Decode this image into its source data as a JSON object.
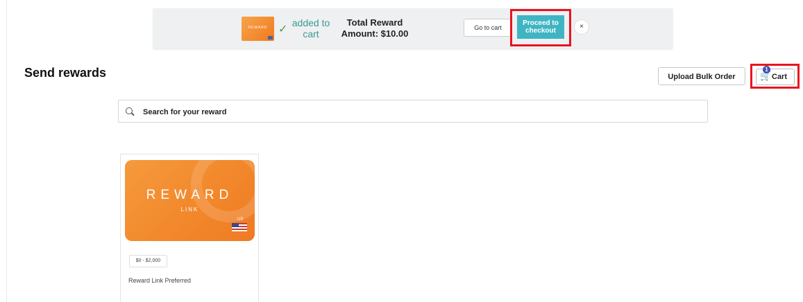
{
  "notification": {
    "card_thumbnail_text": "REWARD",
    "added_line1": "added to",
    "added_line2": "cart",
    "total_line1": "Total Reward",
    "total_line2": "Amount: $10.00",
    "go_to_cart_label": "Go to cart",
    "proceed_line1": "Proceed to",
    "proceed_line2": "checkout",
    "close_label": "×"
  },
  "header": {
    "title": "Send rewards",
    "upload_bulk_label": "Upload Bulk Order",
    "cart_label": "Cart",
    "cart_count": "1"
  },
  "search": {
    "placeholder": "Search for your reward"
  },
  "rewards": [
    {
      "brand": "REWARD",
      "brand_sub": "LINK",
      "region": "US",
      "price_range": "$0 - $2,000",
      "name": "Reward Link Preferred"
    }
  ],
  "colors": {
    "highlight_red": "#e8141f",
    "proceed_teal": "#3fb5c4",
    "card_orange": "#f28a2c"
  }
}
